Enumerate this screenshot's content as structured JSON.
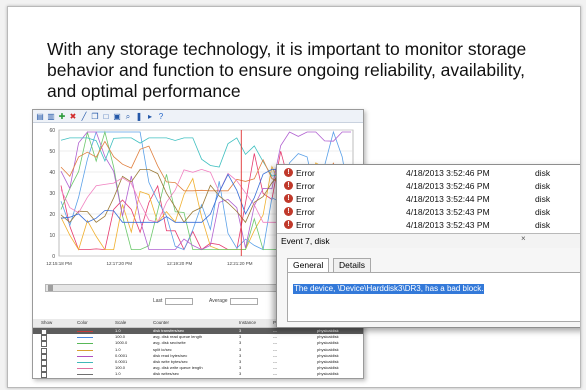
{
  "slide": {
    "heading": "With any storage technology, it is important to monitor storage behavior and function to ensure ongoing reliability, availability, and optimal performance"
  },
  "perfmon": {
    "toolbar_icons": [
      "view-graph-icon",
      "change-graph-icon",
      "add-counter-icon",
      "delete-counter-icon",
      "highlight-icon",
      "copy-icon",
      "paste-icon",
      "properties-icon",
      "zoom-icon",
      "freeze-icon",
      "update-icon",
      "help-icon"
    ],
    "y_ticks": [
      "60",
      "50",
      "40",
      "30",
      "20",
      "10",
      "0"
    ],
    "x_ticks": [
      "12:15:18 PM",
      "12:17:20 PM",
      "12:19:20 PM",
      "12:21:20 PM",
      "12:22:2"
    ],
    "stats": {
      "last_label": "Last",
      "average_label": "Average"
    },
    "columns": [
      "Show",
      "Color",
      "Scale",
      "Counter",
      "Instance",
      "Parent",
      "Object"
    ],
    "counters": [
      {
        "scale": "1.0",
        "counter": "disk transfers/sec",
        "instance": "3",
        "parent": "---",
        "object": "physicaldisk",
        "color": "#c43b3b",
        "selected": true
      },
      {
        "scale": "100.0",
        "counter": "avg. disk read queue length",
        "instance": "3",
        "parent": "---",
        "object": "physicaldisk",
        "color": "#4a8be0",
        "selected": false
      },
      {
        "scale": "1000.0",
        "counter": "avg. disk sec/write",
        "instance": "3",
        "parent": "---",
        "object": "physicaldisk",
        "color": "#58b858",
        "selected": false
      },
      {
        "scale": "1.0",
        "counter": "split io/sec",
        "instance": "3",
        "parent": "---",
        "object": "physicaldisk",
        "color": "#d8a030",
        "selected": false
      },
      {
        "scale": "0.0001",
        "counter": "disk read bytes/sec",
        "instance": "3",
        "parent": "---",
        "object": "physicaldisk",
        "color": "#b050c0",
        "selected": false
      },
      {
        "scale": "0.0001",
        "counter": "disk write bytes/sec",
        "instance": "3",
        "parent": "---",
        "object": "physicaldisk",
        "color": "#40b8b8",
        "selected": false
      },
      {
        "scale": "100.0",
        "counter": "avg. disk write queue length",
        "instance": "3",
        "parent": "---",
        "object": "physicaldisk",
        "color": "#e070a0",
        "selected": false
      },
      {
        "scale": "1.0",
        "counter": "disk writes/sec",
        "instance": "3",
        "parent": "---",
        "object": "physicaldisk",
        "color": "#707070",
        "selected": false
      }
    ],
    "graph_colors": [
      "#e63b6e",
      "#f0b030",
      "#5aa0e8",
      "#6cc86c",
      "#b060d0",
      "#40c0c0",
      "#e08040",
      "#9b7b3a",
      "#f080c0",
      "#3a6fd8"
    ]
  },
  "event_viewer": {
    "events": [
      {
        "level": "Error",
        "date": "4/18/2013 3:52:46 PM",
        "source": "disk"
      },
      {
        "level": "Error",
        "date": "4/18/2013 3:52:46 PM",
        "source": "disk"
      },
      {
        "level": "Error",
        "date": "4/18/2013 3:52:44 PM",
        "source": "disk"
      },
      {
        "level": "Error",
        "date": "4/18/2013 3:52:43 PM",
        "source": "disk"
      },
      {
        "level": "Error",
        "date": "4/18/2013 3:52:43 PM",
        "source": "disk"
      }
    ],
    "detail_title": "Event 7, disk",
    "close_glyph": "×",
    "tabs": [
      "General",
      "Details"
    ],
    "message": "The device, \\Device\\Harddisk3\\DR3, has a bad block."
  }
}
